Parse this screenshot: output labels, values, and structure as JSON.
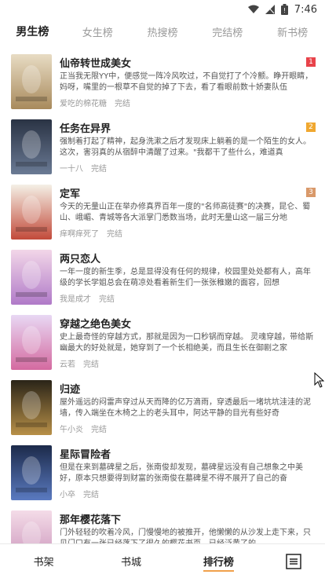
{
  "status": {
    "time": "7:46"
  },
  "tabs": [
    {
      "label": "男生榜",
      "active": true
    },
    {
      "label": "女生榜"
    },
    {
      "label": "热搜榜"
    },
    {
      "label": "完结榜"
    },
    {
      "label": "新书榜"
    }
  ],
  "books": [
    {
      "title": "仙帝转世成美女",
      "rank": "1",
      "rank_color": "#e8434a",
      "desc": "正当我无限YY中，便感觉一阵冷风吹过，不自觉打了个冷颤。睁开眼睛，妈呀，嘴里的一根草不自觉的掉了下去，看了看眼前数十娇妻队伍",
      "author": "爱吃的棉花糖",
      "status": "完结"
    },
    {
      "title": "任务在异界",
      "rank": "2",
      "rank_color": "#f0a830",
      "desc": "强制着打起了精神，起身洗漱之后才发现床上躺着的是一个陌生的女人。这次，害羽真的从宿醉中清醒了过来。\"我都干了些什么，难道真",
      "author": "一十八",
      "status": "完结"
    },
    {
      "title": "定军",
      "rank": "3",
      "rank_color": "#d9996a",
      "desc": "今天的无量山正在举办修真界百年一度的\"名师高徒赛\"的决赛，昆仑、蜀山、峨嵋、青城等各大派掌门悉数当场，此时无量山这一届三分地",
      "author": "痒啊痒死了",
      "status": "完结"
    },
    {
      "title": "两只恋人",
      "rank": "",
      "rank_color": "",
      "desc": "一年一度的新生季，总是显得没有任何的规律，校园里处处都有人，高年级的学长学姐总会在萌凉处看着新生们一张张稚嫩的面容，回想",
      "author": "我是成才",
      "status": "完结"
    },
    {
      "title": "穿越之绝色美女",
      "rank": "",
      "rank_color": "",
      "desc": "史上最奇怪的穿越方式，那就是因为一口秒锅而穿越。 灵魂穿越，带给斯幽最大的好处就是，她穿到了一个长相绝美，而且生长在御剧之家",
      "author": "云若",
      "status": "完结"
    },
    {
      "title": "归迹",
      "rank": "",
      "rank_color": "",
      "desc": "屋外遥远的闷雷声穿过从天而降的亿万滴雨，穿透最后一堵坑坑洼洼的泥墙，传入端坐在木椅之上的老头耳中，阿达平静的目光有些好奇",
      "author": "午小炎",
      "status": "完结"
    },
    {
      "title": "星际冒险者",
      "rank": "",
      "rank_color": "",
      "desc": "但是在来到墓碑星之后，张南俊却发现，墓碑星远没有自己想象之中美好，原本只想要得到财富的张南俊在墓碑星不得不展开了自己的奋",
      "author": "小卒",
      "status": "完结"
    },
    {
      "title": "那年樱花落下",
      "rank": "",
      "rank_color": "",
      "desc": "门外轻轻的吹着冷风，门慢慢地的被推开，他懒懒的从沙发上走下来，只见门口有一张已经落下了很久的樱花书页，已经泛黄了的",
      "author": "",
      "status": ""
    }
  ],
  "bottom_nav": [
    {
      "label": "书架"
    },
    {
      "label": "书城"
    },
    {
      "label": "排行榜",
      "active": true
    }
  ]
}
